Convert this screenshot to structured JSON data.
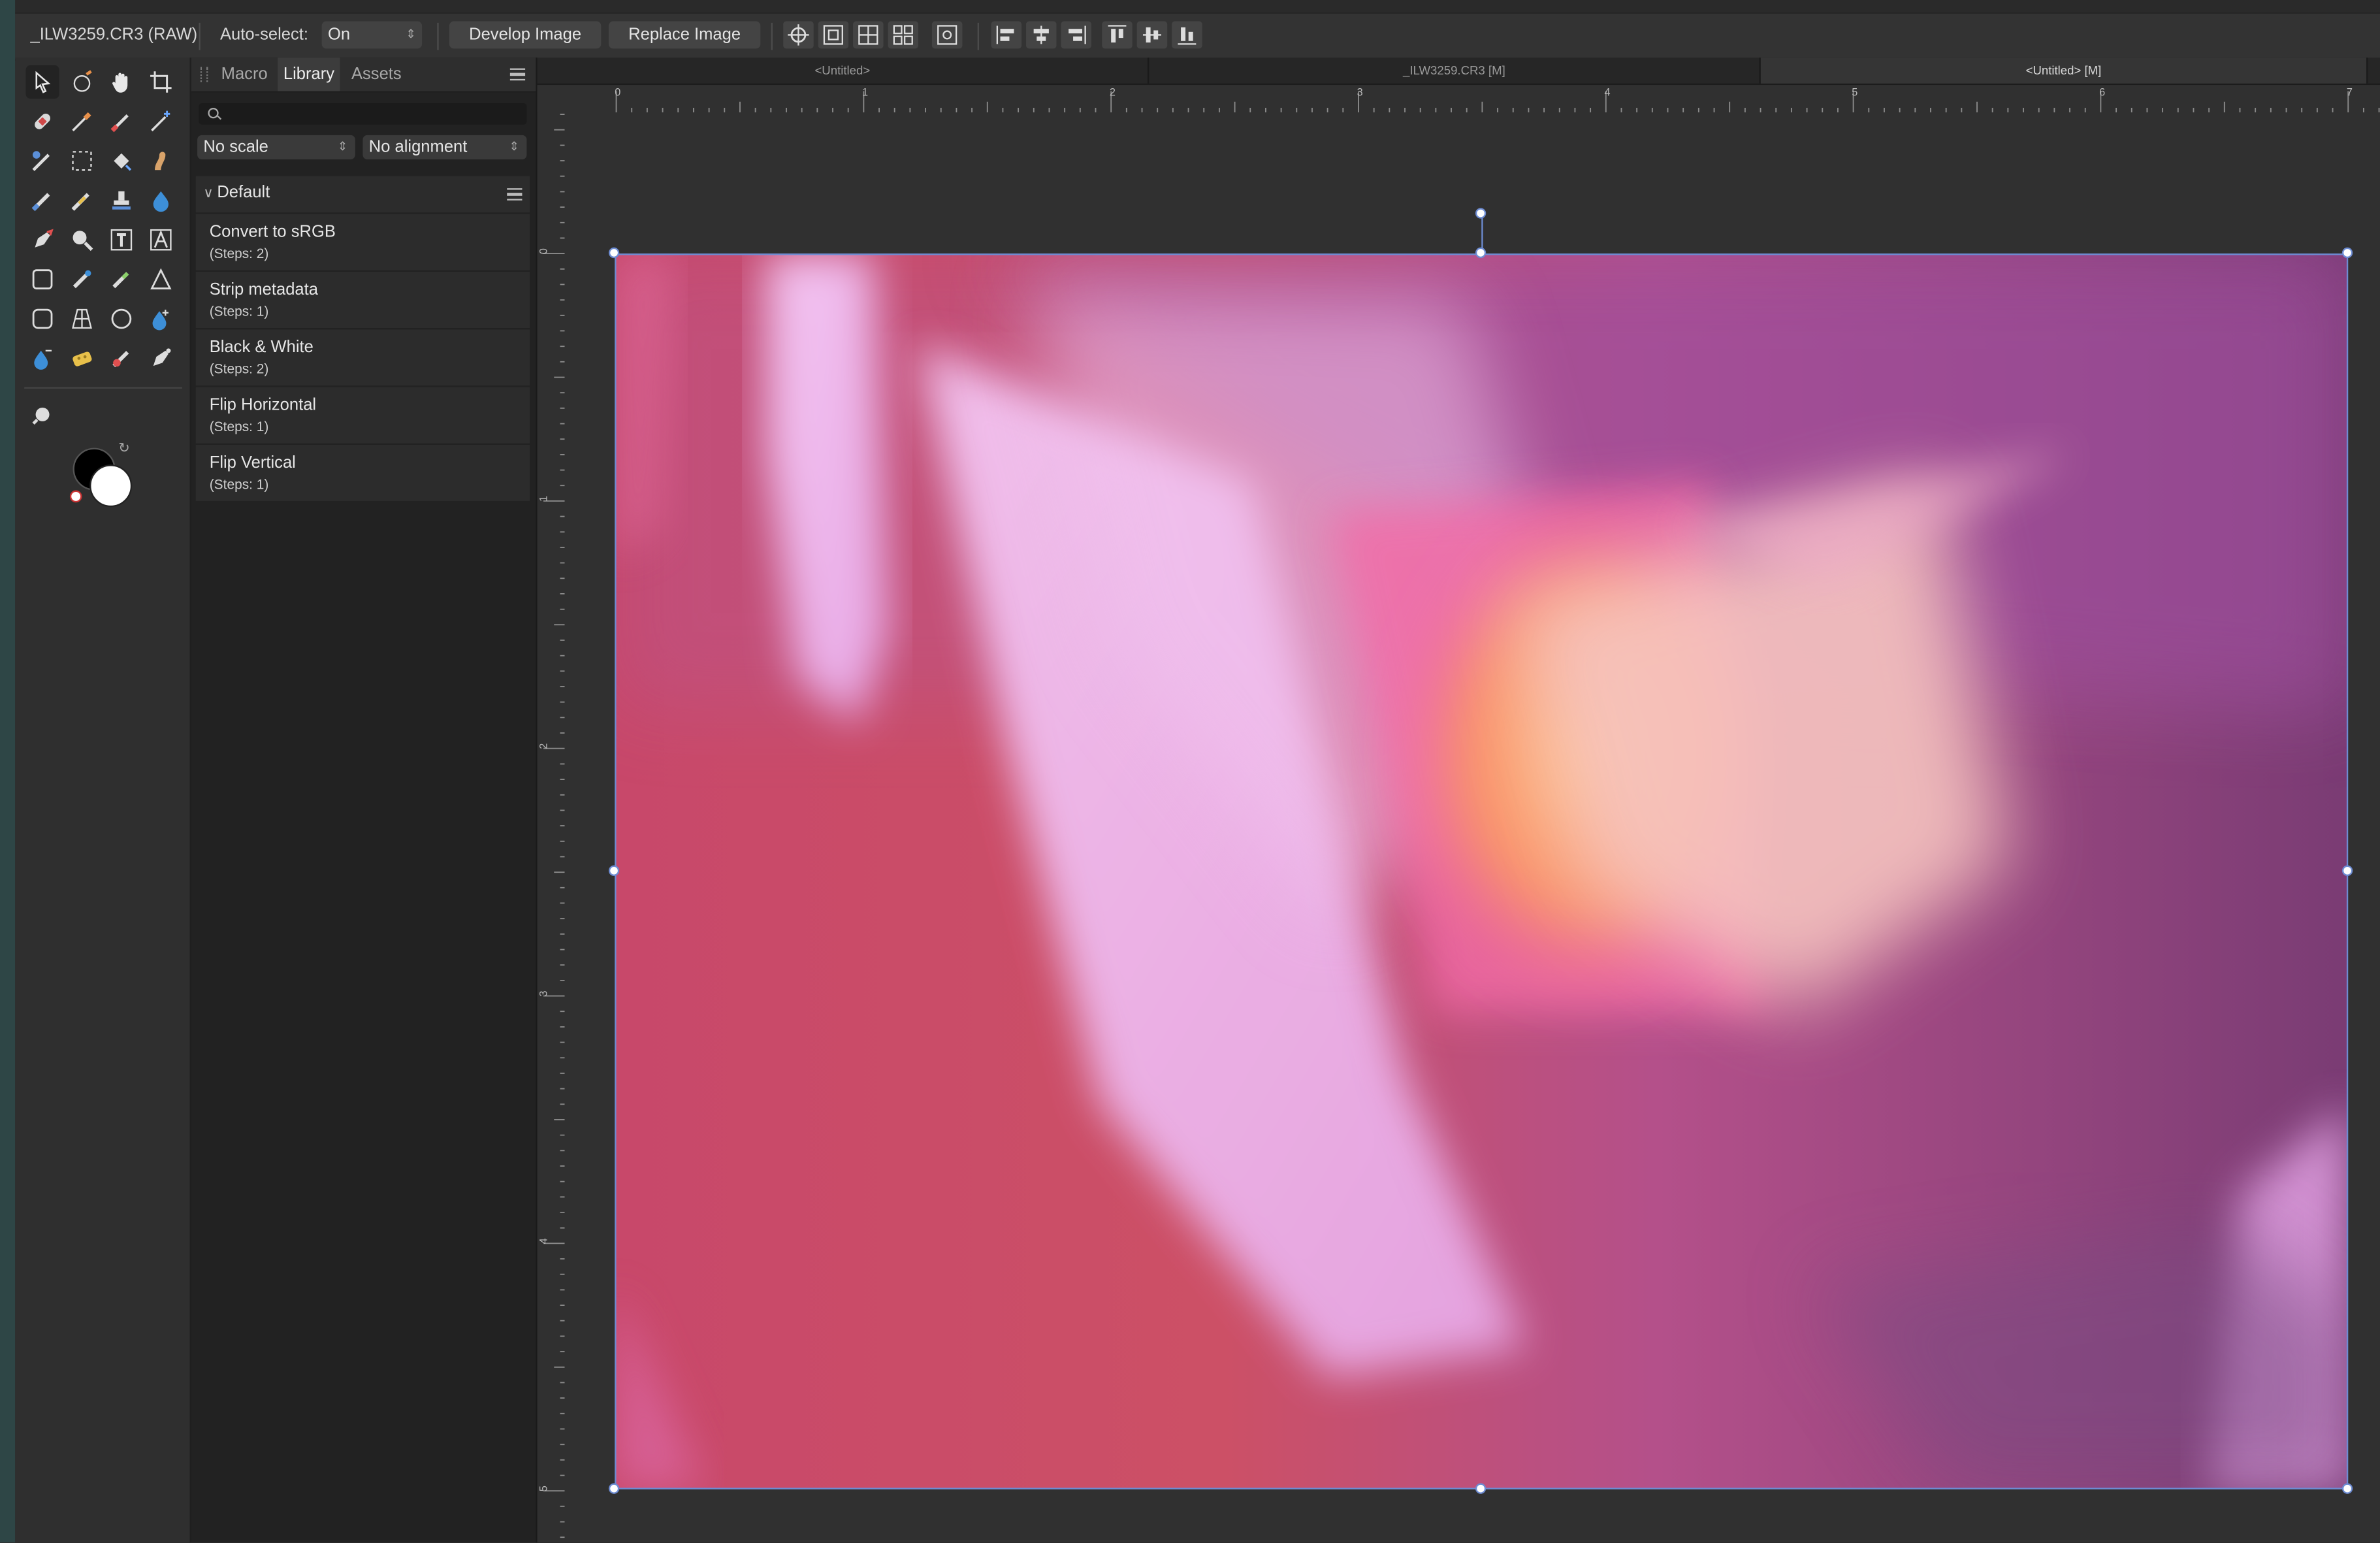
{
  "context_toolbar": {
    "file_label": "_ILW3259.CR3 (RAW)",
    "autoselect_label": "Auto-select:",
    "autoselect_value": "On",
    "develop_label": "Develop Image",
    "replace_label": "Replace Image"
  },
  "library_panel": {
    "tabs": [
      "Macro",
      "Library",
      "Assets"
    ],
    "active_tab": "Library",
    "search_placeholder": "",
    "scale_select": "No scale",
    "alignment_select": "No alignment",
    "category": "Default",
    "macros": [
      {
        "name": "Convert to sRGB",
        "steps": "(Steps: 2)"
      },
      {
        "name": "Strip metadata",
        "steps": "(Steps: 1)"
      },
      {
        "name": "Black & White",
        "steps": "(Steps: 2)"
      },
      {
        "name": "Flip Horizontal",
        "steps": "(Steps: 1)"
      },
      {
        "name": "Flip Vertical",
        "steps": "(Steps: 1)"
      }
    ]
  },
  "document_tabs": [
    "<Untitled>",
    "_ILW3259.CR3 [M]",
    "<Untitled> [M]"
  ],
  "active_document_tab": 2,
  "ruler": {
    "unit": "in",
    "h_labels": [
      "0",
      "1",
      "2",
      "3",
      "4",
      "5",
      "6",
      "7"
    ],
    "v_labels": [
      "0",
      "1",
      "2",
      "3",
      "4",
      "5"
    ]
  },
  "colors": {
    "selection": "#6d8cd3",
    "primary_color": "#000000",
    "secondary_color": "#ffffff"
  },
  "icons": {
    "tools": [
      "move-tool-icon",
      "view-tool-icon",
      "hand-tool-icon",
      "crop-tool-icon",
      "healing-tool-icon",
      "color-picker-icon",
      "paint-brush-icon",
      "magic-wand-icon",
      "inpainting-brush-icon",
      "marquee-icon",
      "flood-select-icon",
      "smudge-icon",
      "erase-brush-icon",
      "clone-brush-icon",
      "clone-stamp-icon",
      "fill-drop-icon",
      "pen-tool-icon",
      "zoom-tool-icon",
      "frame-text-icon",
      "artistic-text-icon",
      "rectangle-icon",
      "blemish-remover-icon",
      "dodge-brush-icon",
      "triangle-icon",
      "rounded-rect-icon",
      "perspective-icon",
      "ellipse-icon",
      "burn-drop-icon",
      "sponge-drop-icon",
      "sponge-icon",
      "red-eye-icon",
      "node-tool-icon",
      "zoom-tool-alt-icon"
    ]
  }
}
